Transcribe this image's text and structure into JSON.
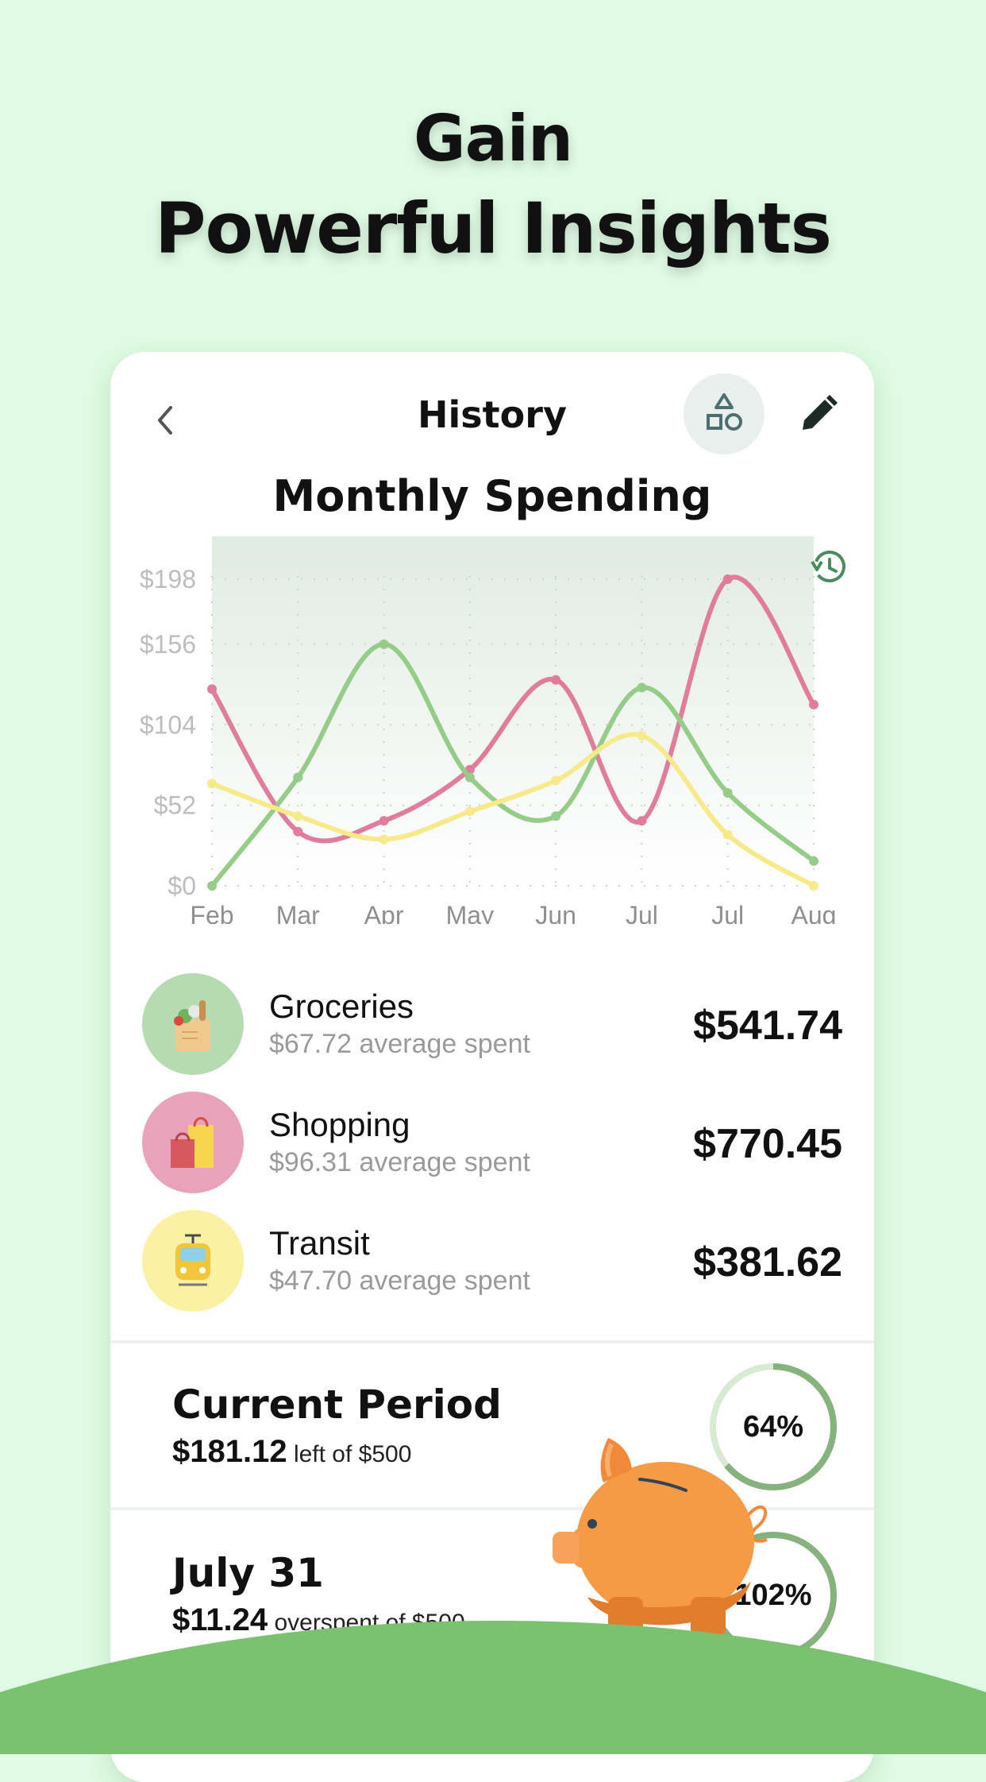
{
  "headline": {
    "line1": "Gain",
    "line2": "Powerful Insights"
  },
  "header": {
    "title": "History",
    "icons": [
      "chevron-left-icon",
      "shapes-icon",
      "pencil-icon"
    ]
  },
  "chart_data": {
    "type": "line",
    "title": "Monthly Spending",
    "categories": [
      "Feb",
      "Mar",
      "Apr",
      "May",
      "Jun",
      "Jul",
      "Jul",
      "Aug"
    ],
    "y_ticks": [
      "$0",
      "$52",
      "$104",
      "$156",
      "$198"
    ],
    "ylim": [
      0,
      198
    ],
    "grid": true,
    "series": [
      {
        "color": "#e07c9c",
        "values": [
          127,
          35,
          42,
          75,
          133,
          42,
          198,
          117
        ]
      },
      {
        "color": "#94cc88",
        "values": [
          0,
          70,
          156,
          70,
          45,
          128,
          60,
          16
        ]
      },
      {
        "color": "#f7ea8a",
        "values": [
          66,
          45,
          30,
          48,
          68,
          97,
          33,
          0
        ]
      }
    ]
  },
  "categories": [
    {
      "name": "Groceries",
      "avg": "$67.72 average spent",
      "total": "$541.74",
      "color": "#b6dab1",
      "icon": "grocery-bag-icon"
    },
    {
      "name": "Shopping",
      "avg": "$96.31 average spent",
      "total": "$770.45",
      "color": "#e8a2ba",
      "icon": "shopping-bags-icon"
    },
    {
      "name": "Transit",
      "avg": "$47.70 average spent",
      "total": "$381.62",
      "color": "#fbf1a4",
      "icon": "tram-icon"
    }
  ],
  "periods": [
    {
      "title": "Current Period",
      "amount": "$181.12",
      "note": "left of $500",
      "percent_label": "64%",
      "percent": 64
    },
    {
      "title": "July 31",
      "amount": "$11.24",
      "note": "overspent of $500",
      "percent_label": "102%",
      "percent": 102
    }
  ],
  "colors": {
    "background": "#dffbe3",
    "hill": "#7ac170",
    "ring": "#86b27e",
    "ring_track": "#d7ebd3",
    "accent": "#4b8a5b"
  }
}
